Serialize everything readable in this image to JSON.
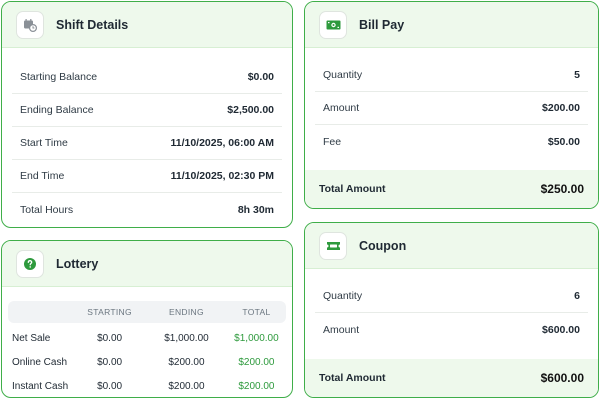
{
  "shift": {
    "title": "Shift Details",
    "rows": [
      {
        "label": "Starting Balance",
        "value": "$0.00"
      },
      {
        "label": "Ending Balance",
        "value": "$2,500.00"
      },
      {
        "label": "Start Time",
        "value": "11/10/2025, 06:00 AM"
      },
      {
        "label": "End Time",
        "value": "11/10/2025, 02:30 PM"
      },
      {
        "label": "Total Hours",
        "value": "8h 30m"
      }
    ]
  },
  "lottery": {
    "title": "Lottery",
    "columns": [
      "STARTING",
      "ENDING",
      "TOTAL"
    ],
    "rows": [
      {
        "label": "Net Sale",
        "starting": "$0.00",
        "ending": "$1,000.00",
        "total": "$1,000.00"
      },
      {
        "label": "Online Cash",
        "starting": "$0.00",
        "ending": "$200.00",
        "total": "$200.00"
      },
      {
        "label": "Instant Cash",
        "starting": "$0.00",
        "ending": "$200.00",
        "total": "$200.00"
      }
    ]
  },
  "bill_pay": {
    "title": "Bill Pay",
    "rows": [
      {
        "label": "Quantity",
        "value": "5"
      },
      {
        "label": "Amount",
        "value": "$200.00"
      },
      {
        "label": "Fee",
        "value": "$50.00"
      }
    ],
    "total_label": "Total Amount",
    "total_value": "$250.00"
  },
  "coupon": {
    "title": "Coupon",
    "rows": [
      {
        "label": "Quantity",
        "value": "6"
      },
      {
        "label": "Amount",
        "value": "$600.00"
      }
    ],
    "total_label": "Total Amount",
    "total_value": "$600.00"
  },
  "icons": {
    "shift": "calendar-clock-icon",
    "lottery": "question-circle-icon",
    "bill_pay": "banknote-icon",
    "coupon": "ticket-icon"
  },
  "colors": {
    "accent": "#3fae49",
    "header_bg": "#eef9ec",
    "positive": "#2e9a3d"
  }
}
